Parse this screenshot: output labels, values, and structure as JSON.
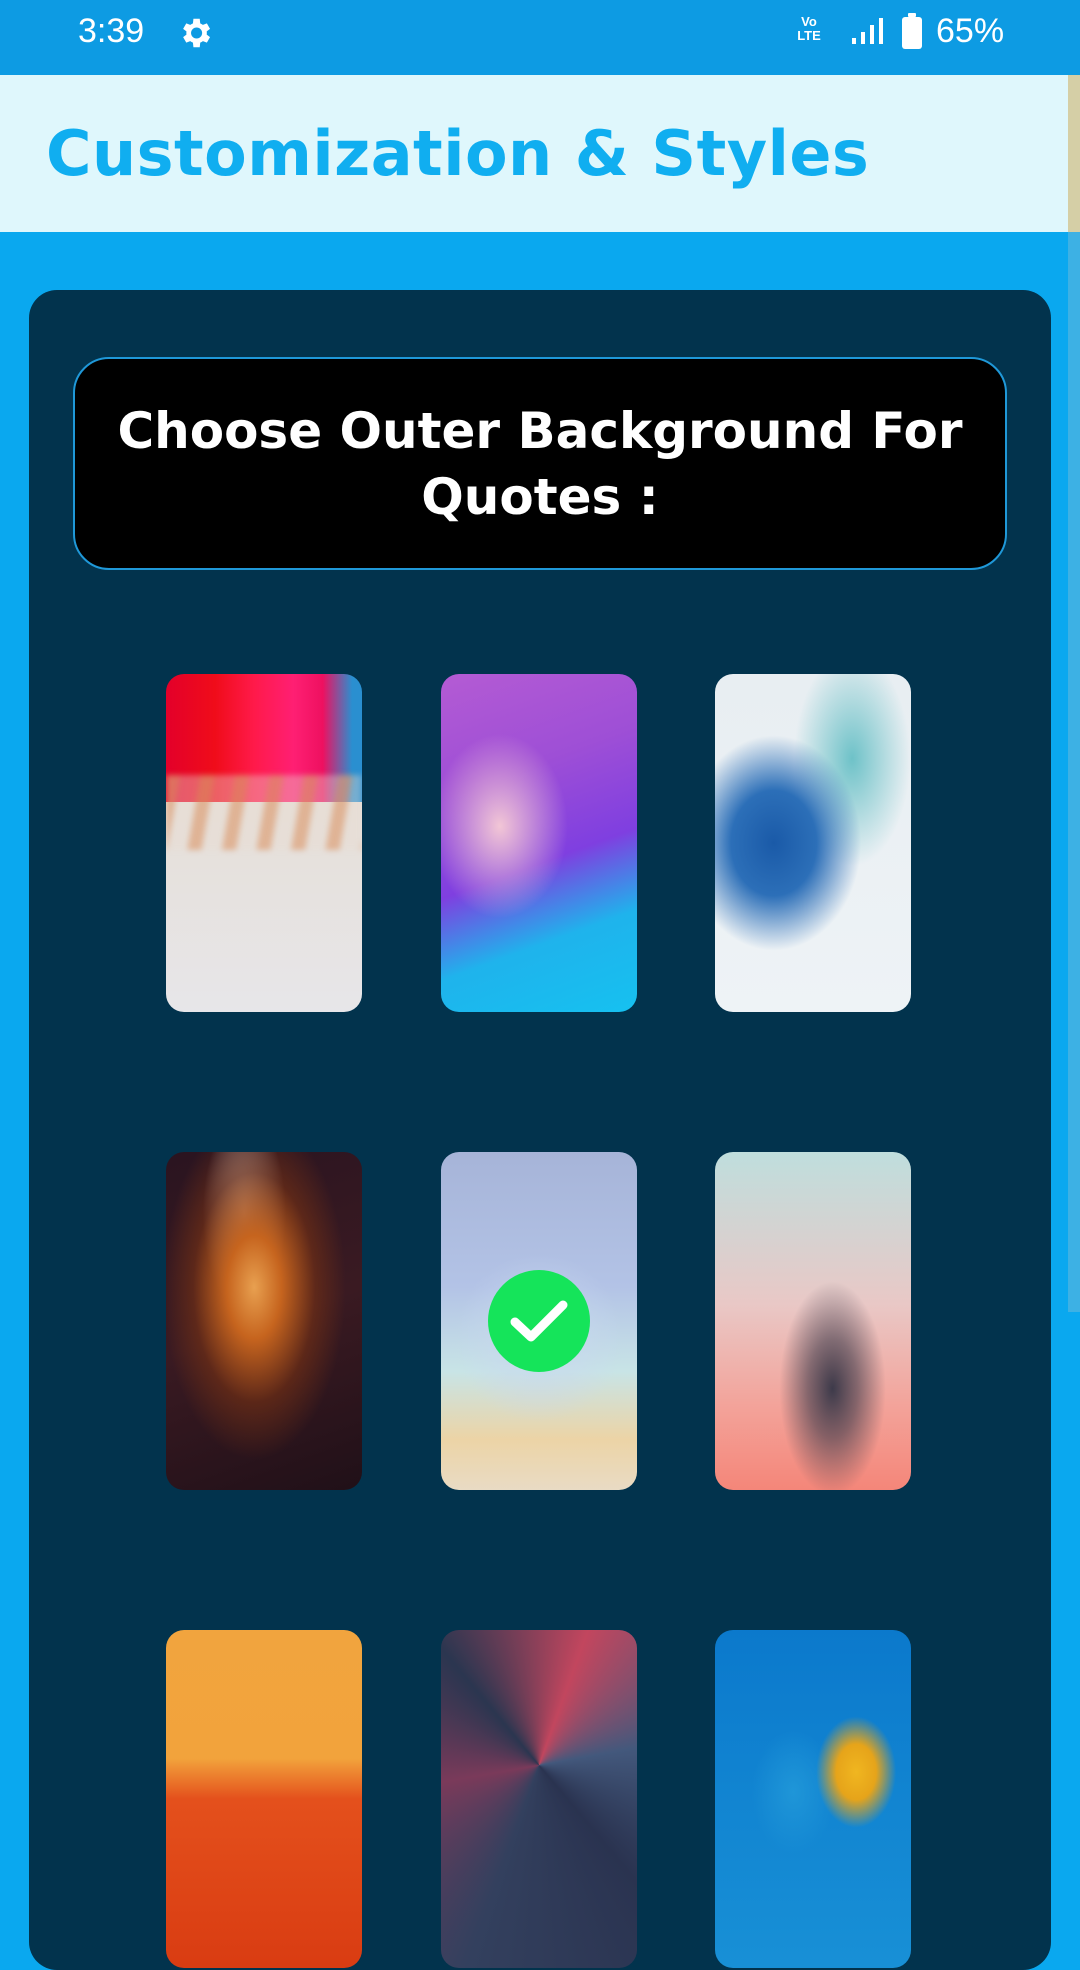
{
  "status_bar": {
    "time": "3:39",
    "volte_line1": "Vo",
    "volte_line2": "LTE",
    "battery_percent": "65%",
    "icons": [
      "settings-gear-icon",
      "volte-icon",
      "signal-icon",
      "battery-icon"
    ]
  },
  "header": {
    "title": "Customization & Styles"
  },
  "section": {
    "heading": "Choose Outer Background For Quotes :"
  },
  "backgrounds": [
    {
      "name": "pencils",
      "selected": false
    },
    {
      "name": "purple-wave",
      "selected": false
    },
    {
      "name": "blue-ink",
      "selected": false
    },
    {
      "name": "orange-swirl",
      "selected": false
    },
    {
      "name": "pastel",
      "selected": true
    },
    {
      "name": "pink-hand",
      "selected": false
    },
    {
      "name": "orange-red",
      "selected": false
    },
    {
      "name": "geometric",
      "selected": false
    },
    {
      "name": "blue-moon",
      "selected": false
    }
  ],
  "colors": {
    "status_bar": "#0d9be3",
    "page_background": "#0aa8ef",
    "header_background": "#dff7fc",
    "title": "#10aef0",
    "panel": "#02334d",
    "heading_box": "#000000",
    "heading_border": "#1f98d8",
    "checkmark_badge": "#15e45a"
  }
}
